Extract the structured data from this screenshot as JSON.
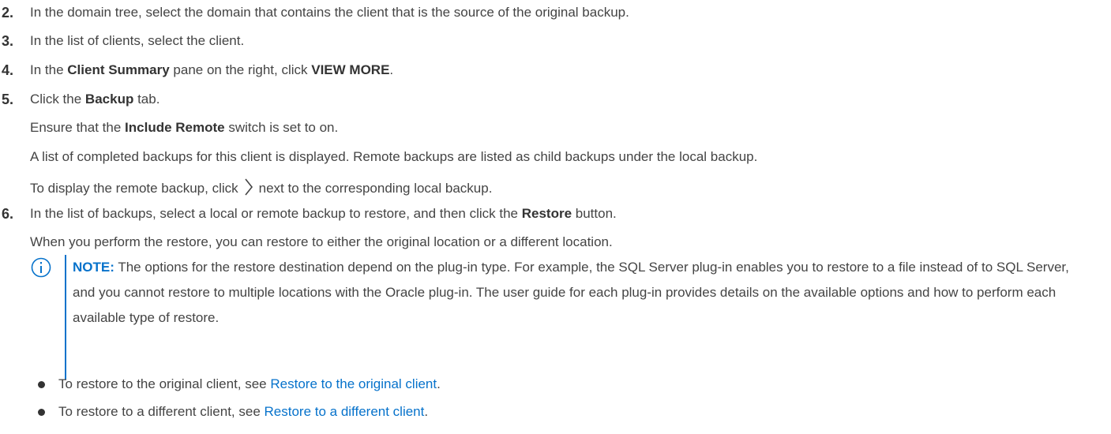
{
  "steps": [
    {
      "num": "2.",
      "pre": "In the domain tree, select the domain that contains the client that is the source of the original backup."
    },
    {
      "num": "3.",
      "pre": "In the list of clients, select the client."
    },
    {
      "num": "4.",
      "pre": "In the ",
      "b1": "Client Summary",
      "mid": " pane on the right, click ",
      "b2": "VIEW MORE",
      "post": "."
    },
    {
      "num": "5.",
      "pre": "Click the ",
      "b1": "Backup",
      "post": " tab."
    },
    {
      "num": "6.",
      "pre": "In the list of backups, select a local or remote backup to restore, and then click the ",
      "b1": "Restore",
      "post": " button."
    }
  ],
  "step5_sub": {
    "line1_pre": "Ensure that the ",
    "line1_b": "Include Remote",
    "line1_post": " switch is set to on.",
    "line2": "A list of completed backups for this client is displayed. Remote backups are listed as child backups under the local backup.",
    "line3_pre": "To display the remote backup, click",
    "line3_post": "next to the corresponding local backup.",
    "chevron_icon": "chevron-right-icon"
  },
  "step6_sub": {
    "line1": "When you perform the restore, you can restore to either the original location or a different location."
  },
  "note": {
    "label": "NOTE:",
    "text": "The options for the restore destination depend on the plug-in type. For example, the SQL Server plug-in enables you to restore to a file instead of to SQL Server, and you cannot restore to multiple locations with the Oracle plug-in. The user guide for each plug-in provides details on the available options and how to perform each available type of restore.",
    "icon": "info-icon",
    "accent_color": "#0672cb"
  },
  "bullets": [
    {
      "pre": "To restore to the original client, see ",
      "link": "Restore to the original client",
      "post": "."
    },
    {
      "pre": "To restore to a different client, see ",
      "link": "Restore to a different client",
      "post": "."
    }
  ]
}
